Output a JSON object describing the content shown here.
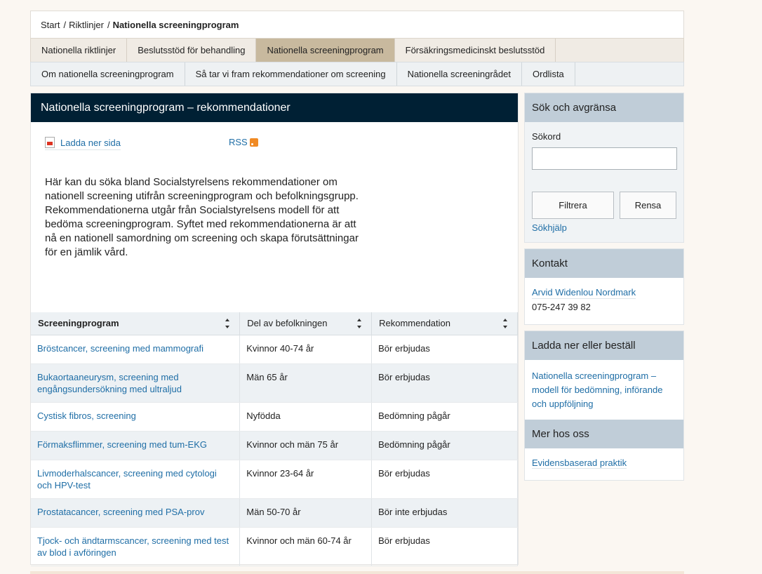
{
  "breadcrumb": {
    "items": [
      "Start",
      "Riktlinjer"
    ],
    "separator": "/",
    "current": "Nationella screeningprogram"
  },
  "nav_primary": {
    "items": [
      {
        "label": "Nationella riktlinjer",
        "active": false
      },
      {
        "label": "Beslutsstöd för behandling",
        "active": false
      },
      {
        "label": "Nationella screeningprogram",
        "active": true
      },
      {
        "label": "Försäkringsmedicinskt beslutsstöd",
        "active": false
      }
    ]
  },
  "nav_secondary": {
    "items": [
      {
        "label": "Om nationella screeningprogram"
      },
      {
        "label": "Så tar vi fram rekommendationer om screening"
      },
      {
        "label": "Nationella screeningrådet"
      },
      {
        "label": "Ordlista"
      }
    ]
  },
  "main": {
    "title": "Nationella screeningprogram – rekommendationer",
    "download_label": "Ladda ner sida",
    "rss_label": "RSS",
    "intro": "Här kan du söka bland Socialstyrelsens rekommendationer om nationell screening utifrån screeningprogram och befolkningsgrupp. Rekommendationerna utgår från Socialstyrelsens modell för att bedöma screeningprogram. Syftet med rekommendationerna är att nå en nationell samordning om screening och skapa förutsättningar för en jämlik vård.",
    "table": {
      "headers": [
        "Screeningprogram",
        "Del av befolkningen",
        "Rekommendation"
      ],
      "rows": [
        {
          "program": "Bröstcancer, screening med mammografi",
          "population": "Kvinnor 40-74 år",
          "recommendation": "Bör erbjudas"
        },
        {
          "program": "Bukaortaaneurysm, screening med engångsundersökning med ultraljud",
          "population": "Män 65 år",
          "recommendation": "Bör erbjudas"
        },
        {
          "program": "Cystisk fibros, screening",
          "population": "Nyfödda",
          "recommendation": "Bedömning pågår"
        },
        {
          "program": "Förmaksflimmer, screening med tum-EKG",
          "population": "Kvinnor och män 75 år",
          "recommendation": "Bedömning pågår"
        },
        {
          "program": "Livmoderhalscancer, screening med cytologi och HPV-test",
          "population": "Kvinnor 23-64 år",
          "recommendation": "Bör erbjudas"
        },
        {
          "program": "Prostatacancer, screening med PSA-prov",
          "population": "Män 50-70 år",
          "recommendation": "Bör inte erbjudas"
        },
        {
          "program": "Tjock- och ändtarmscancer, screening med test av blod i avföringen",
          "population": "Kvinnor och män 60-74 år",
          "recommendation": "Bör erbjudas"
        }
      ]
    }
  },
  "sidebar": {
    "search": {
      "title": "Sök och avgränsa",
      "field_label": "Sökord",
      "field_value": "",
      "filter_label": "Filtrera",
      "reset_label": "Rensa",
      "help_label": "Sökhjälp"
    },
    "contact": {
      "title": "Kontakt",
      "name": "Arvid Widenlou Nordmark",
      "phone": "075-247 39 82"
    },
    "download": {
      "title": "Ladda ner eller beställ",
      "doc_label": "Nationella screeningprogram – modell för bedömning, införande och uppföljning"
    },
    "more": {
      "title": "Mer hos oss",
      "link_label": "Evidensbaserad praktik"
    }
  }
}
